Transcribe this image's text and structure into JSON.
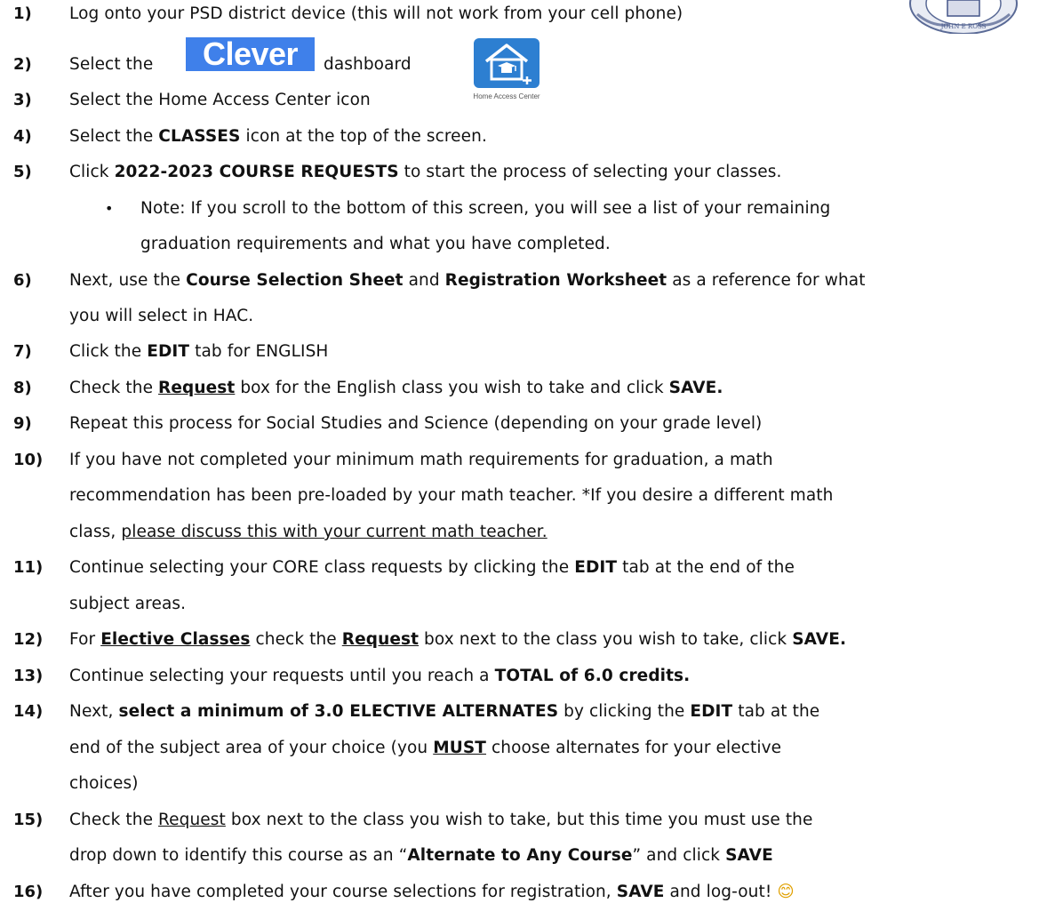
{
  "steps": {
    "s1": {
      "num": "1)",
      "text": "Log onto your PSD district device (this will not work from your cell phone)"
    },
    "s2": {
      "num": "2)",
      "pre": "Select the",
      "post": "dashboard"
    },
    "s3": {
      "num": "3)",
      "text": "Select the Home Access Center icon"
    },
    "s4": {
      "num": "4)",
      "pre": "Select the ",
      "bold": "CLASSES",
      "post": " icon at the top of the screen."
    },
    "s5": {
      "num": "5)",
      "pre": "Click ",
      "bold": "2022-2023 COURSE REQUESTS",
      "post": " to start the process of selecting your classes."
    },
    "note": {
      "line1": "Note: If you scroll to the bottom of this screen, you will see a list of your remaining",
      "line2": "graduation requirements and what you have completed."
    },
    "s6": {
      "num": "6)",
      "pre": "Next, use the ",
      "b1": "Course Selection Sheet",
      "mid": " and ",
      "b2": "Registration Worksheet",
      "post": " as a reference for what",
      "line2": "you will select in HAC."
    },
    "s7": {
      "num": "7)",
      "pre": "Click the ",
      "bold": "EDIT",
      "post": " tab for ENGLISH"
    },
    "s8": {
      "num": "8)",
      "pre": "Check the ",
      "underline": "Request",
      "mid": " box for the English class you wish to take and click ",
      "bold": "SAVE",
      "post": "."
    },
    "s9": {
      "num": "9)",
      "text": "Repeat this process for Social Studies and Science (depending on your grade level)"
    },
    "s10": {
      "num": "10)",
      "line1": "If you have not completed your minimum math requirements for graduation, a math",
      "line2": "recommendation has been pre-loaded by your math teacher.  *If you desire a different math",
      "line3pre": "class, ",
      "line3u": "please discuss this with your current math teacher."
    },
    "s11": {
      "num": "11)",
      "pre": "Continue selecting your CORE class requests by clicking the ",
      "bold": "EDIT",
      "post": " tab at the end of the",
      "line2": "subject areas."
    },
    "s12": {
      "num": "12)",
      "pre": "For ",
      "ub1": "Elective Classes",
      "mid1": " check the ",
      "ub2": "Request",
      "mid2": " box next to the class you wish to take, click ",
      "bold": "SAVE",
      "post": "."
    },
    "s13": {
      "num": "13)",
      "pre": "Continue selecting your requests until you reach a ",
      "bold": "TOTAL of 6.0 credits",
      "post": "."
    },
    "s14": {
      "num": "14)",
      "pre": "Next, ",
      "bold1": "select a minimum of 3.0 ELECTIVE ALTERNATES",
      "mid": " by clicking the ",
      "bold2": "EDIT",
      "post": " tab at the",
      "line2pre": "end of the subject area of your choice (you ",
      "line2ub": "MUST",
      "line2post": " choose alternates for your elective",
      "line3": "choices)"
    },
    "s15": {
      "num": "15)",
      "pre": "Check the ",
      "underline": "Request",
      "post": " box next to the class you wish to take, but this time you must use the",
      "line2pre": "drop down to identify this course as an “",
      "line2bold": "Alternate to Any Course",
      "line2mid": "” and click ",
      "line2bold2": "SAVE"
    },
    "s16": {
      "num": "16)",
      "pre": "After you have completed your course selections for registration, ",
      "bold": "SAVE",
      "post": " and log-out! ",
      "emoji": "😊"
    }
  },
  "clever_logo": "Clever",
  "hac_label": "Home Access Center",
  "icons": {
    "hac": "home-access-center-icon",
    "seal": "school-seal-logo",
    "emoji": "smiley-face"
  },
  "colors": {
    "clever_bg": "#3f80ea",
    "hac_bg": "#2d7fd1"
  }
}
